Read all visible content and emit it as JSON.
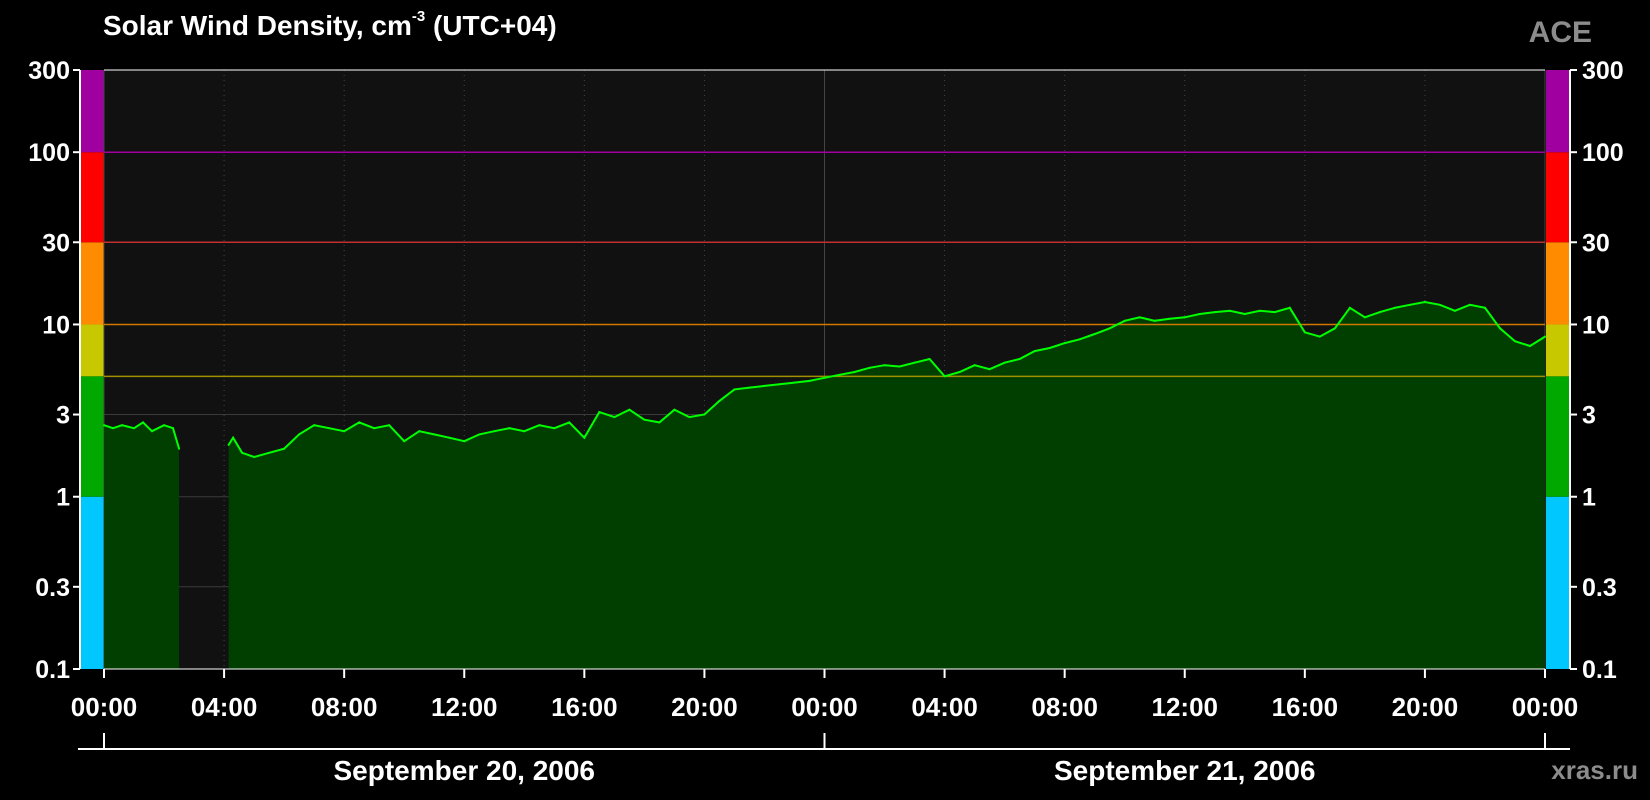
{
  "header": {
    "title_main": "Solar Wind Density, cm",
    "title_sup": "-3",
    "title_tz": " (UTC+04)",
    "source": "ACE",
    "site": "xras.ru"
  },
  "colors": {
    "background": "#000000",
    "plot_area": "#111111",
    "series_line": "#00ff00",
    "series_fill": "#003f00",
    "level_bands": [
      "#00c8ff",
      "#00a800",
      "#c8c800",
      "#ff8c00",
      "#ff0000",
      "#a000a0"
    ],
    "threshold_lines": [
      "#a000a0",
      "#c03030",
      "#d07800",
      "#a09000"
    ]
  },
  "chart_data": {
    "type": "area",
    "scale": "log",
    "ylim": [
      0.1,
      300
    ],
    "yticks": [
      0.1,
      0.3,
      1,
      3,
      10,
      30,
      100,
      300
    ],
    "ytick_labels": [
      "0.1",
      "0.3",
      "1",
      "3",
      "10",
      "30",
      "100",
      "300"
    ],
    "xlim_hours": [
      0,
      48
    ],
    "xtick_labels": [
      "00:00",
      "04:00",
      "08:00",
      "12:00",
      "16:00",
      "20:00",
      "00:00",
      "04:00",
      "08:00",
      "12:00",
      "16:00",
      "20:00",
      "00:00"
    ],
    "date_labels": [
      "September 20, 2006",
      "September 21, 2006"
    ],
    "level_bands": [
      [
        0.1,
        1
      ],
      [
        1,
        5
      ],
      [
        5,
        10
      ],
      [
        10,
        30
      ],
      [
        30,
        100
      ],
      [
        100,
        300
      ]
    ],
    "threshold_lines": [
      100,
      30,
      10,
      5
    ],
    "data_gaps_hours": [
      [
        2.5,
        4.15
      ]
    ],
    "series": [
      {
        "x_hours": [
          0.0,
          0.3,
          0.6,
          1.0,
          1.3,
          1.6,
          2.0,
          2.3,
          2.5,
          4.15,
          4.3,
          4.6,
          5.0,
          5.5,
          6.0,
          6.5,
          7.0,
          7.5,
          8.0,
          8.5,
          9.0,
          9.5,
          10.0,
          10.5,
          11.0,
          11.5,
          12.0,
          12.5,
          13.0,
          13.5,
          14.0,
          14.5,
          15.0,
          15.5,
          16.0,
          16.5,
          17.0,
          17.5,
          18.0,
          18.5,
          19.0,
          19.5,
          20.0,
          20.5,
          21.0,
          21.5,
          22.0,
          22.5,
          23.0,
          23.5,
          24.0,
          24.5,
          25.0,
          25.5,
          26.0,
          26.5,
          27.0,
          27.5,
          28.0,
          28.5,
          29.0,
          29.5,
          30.0,
          30.5,
          31.0,
          31.5,
          32.0,
          32.5,
          33.0,
          33.5,
          34.0,
          34.5,
          35.0,
          35.5,
          36.0,
          36.5,
          37.0,
          37.5,
          38.0,
          38.5,
          39.0,
          39.5,
          40.0,
          40.5,
          41.0,
          41.5,
          42.0,
          42.5,
          43.0,
          43.5,
          44.0,
          44.5,
          45.0,
          45.5,
          46.0,
          46.5,
          47.0,
          47.5,
          48.0
        ],
        "y": [
          2.6,
          2.5,
          2.6,
          2.5,
          2.7,
          2.4,
          2.6,
          2.5,
          1.9,
          2.0,
          2.2,
          1.8,
          1.7,
          1.8,
          1.9,
          2.3,
          2.6,
          2.5,
          2.4,
          2.7,
          2.5,
          2.6,
          2.1,
          2.4,
          2.3,
          2.2,
          2.1,
          2.3,
          2.4,
          2.5,
          2.4,
          2.6,
          2.5,
          2.7,
          2.2,
          3.1,
          2.9,
          3.2,
          2.8,
          2.7,
          3.2,
          2.9,
          3.0,
          3.6,
          4.2,
          4.3,
          4.4,
          4.5,
          4.6,
          4.7,
          4.9,
          5.1,
          5.3,
          5.6,
          5.8,
          5.7,
          6.0,
          6.3,
          5.0,
          5.3,
          5.8,
          5.5,
          6.0,
          6.3,
          7.0,
          7.3,
          7.8,
          8.2,
          8.8,
          9.5,
          10.5,
          11.0,
          10.5,
          10.8,
          11.0,
          11.5,
          11.8,
          12.0,
          11.5,
          12.0,
          11.8,
          12.5,
          9.0,
          8.5,
          9.5,
          12.5,
          11.0,
          11.8,
          12.5,
          13.0,
          13.5,
          13.0,
          12.0,
          13.0,
          12.5,
          9.5,
          8.0,
          7.5,
          8.5
        ]
      }
    ]
  }
}
